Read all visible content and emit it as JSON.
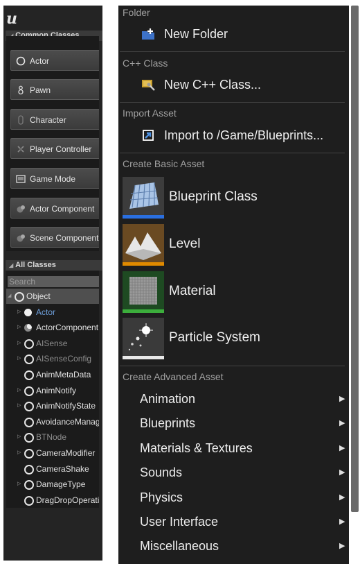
{
  "left_panel": {
    "logo": "u",
    "common_classes_header": "Common Classes",
    "common_classes": [
      {
        "label": "Actor",
        "icon": "actor-sphere-icon"
      },
      {
        "label": "Pawn",
        "icon": "pawn-icon"
      },
      {
        "label": "Character",
        "icon": "character-icon"
      },
      {
        "label": "Player Controller",
        "icon": "player-controller-icon"
      },
      {
        "label": "Game Mode",
        "icon": "game-mode-icon"
      },
      {
        "label": "Actor Component",
        "icon": "actor-component-icon"
      },
      {
        "label": "Scene Component",
        "icon": "scene-component-icon"
      }
    ],
    "all_classes_header": "All Classes",
    "search_placeholder": "Search",
    "tree": [
      {
        "label": "Object",
        "state": "expanded",
        "icon": "object-circle-icon"
      },
      {
        "label": "Actor",
        "state": "collapsed",
        "icon": "actor-dot-icon"
      },
      {
        "label": "ActorComponent",
        "state": "collapsed",
        "icon": "actor-component-icon"
      },
      {
        "label": "AISense",
        "state": "collapsed",
        "icon": "object-circle-icon"
      },
      {
        "label": "AISenseConfig",
        "state": "collapsed",
        "icon": "object-circle-icon"
      },
      {
        "label": "AnimMetaData",
        "state": "leaf",
        "icon": "object-circle-icon"
      },
      {
        "label": "AnimNotify",
        "state": "collapsed",
        "icon": "object-circle-icon"
      },
      {
        "label": "AnimNotifyState",
        "state": "collapsed",
        "icon": "object-circle-icon"
      },
      {
        "label": "AvoidanceManager",
        "state": "leaf",
        "icon": "object-circle-icon"
      },
      {
        "label": "BTNode",
        "state": "collapsed",
        "icon": "object-circle-icon"
      },
      {
        "label": "CameraModifier",
        "state": "collapsed",
        "icon": "object-circle-icon"
      },
      {
        "label": "CameraShake",
        "state": "leaf",
        "icon": "object-circle-icon"
      },
      {
        "label": "DamageType",
        "state": "collapsed",
        "icon": "object-circle-icon"
      },
      {
        "label": "DragDropOperation",
        "state": "leaf",
        "icon": "object-circle-icon"
      }
    ]
  },
  "menu": {
    "sections": {
      "folder": "Folder",
      "cpp_class": "C++ Class",
      "import_asset": "Import Asset",
      "create_basic": "Create Basic Asset",
      "create_advanced": "Create Advanced Asset"
    },
    "new_folder": "New Folder",
    "new_cpp_class": "New C++ Class...",
    "import_to": "Import to /Game/Blueprints...",
    "basic_assets": [
      {
        "label": "Blueprint Class",
        "icon": "blueprint-class-icon",
        "accent": "#2a6fe0"
      },
      {
        "label": "Level",
        "icon": "level-icon",
        "accent": "#e08a00"
      },
      {
        "label": "Material",
        "icon": "material-icon",
        "accent": "#3cae3c"
      },
      {
        "label": "Particle System",
        "icon": "particle-system-icon",
        "accent": "#e8e8e8"
      }
    ],
    "advanced_submenus": [
      "Animation",
      "Blueprints",
      "Materials & Textures",
      "Sounds",
      "Physics",
      "User Interface",
      "Miscellaneous"
    ],
    "submenu_arrow": "▶"
  }
}
